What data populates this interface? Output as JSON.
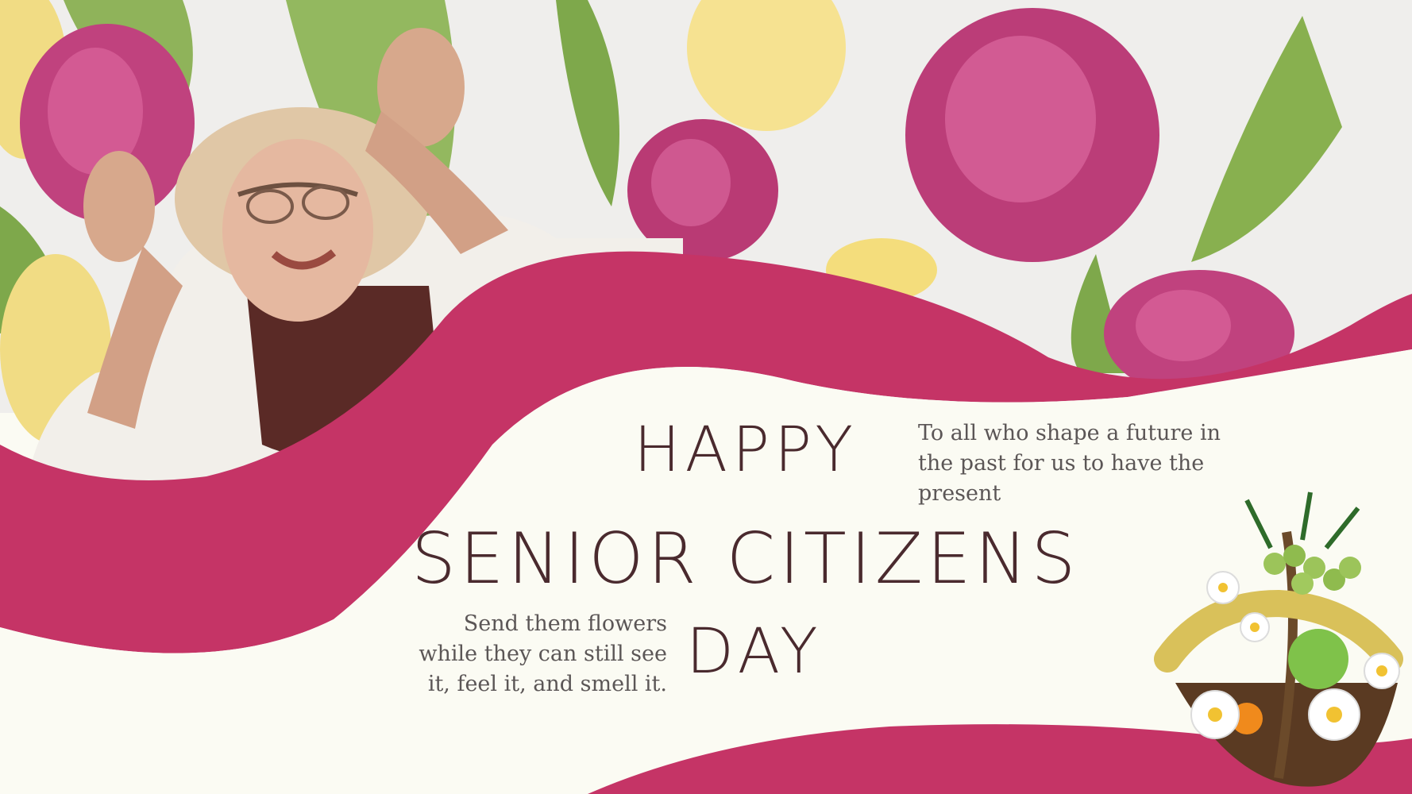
{
  "palette": {
    "background": "#fbfbf3",
    "accent": "#c53466",
    "headline_color": "#4a2a2e",
    "tagline_color": "#5b5656",
    "tulip_pink": "#c0427e",
    "tulip_yellow": "#f5e08a",
    "leaf_green": "#8fb35a"
  },
  "banner": {
    "headline": {
      "line1": "HAPPY",
      "line2": "SENIOR  CITIZENS",
      "line3": "DAY"
    },
    "tagline_top": "To all who shape a future in the past for us to have the present",
    "tagline_bottom": "Send them flowers while they can still see it, feel it, and smell it."
  },
  "imagery": {
    "photo": "smiling elderly woman in sun hat",
    "flowers": "pink and yellow tulips",
    "basket": "fruit and daisy gift basket"
  }
}
